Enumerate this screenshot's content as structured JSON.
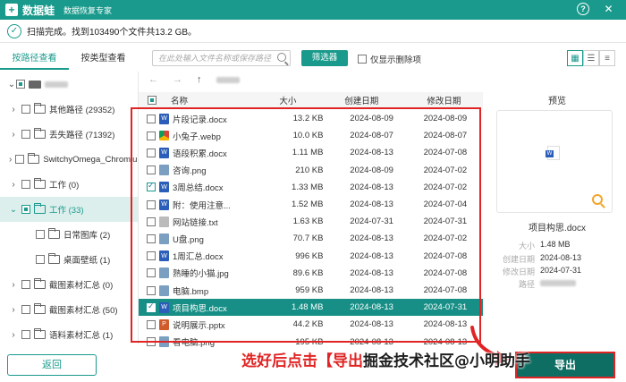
{
  "titlebar": {
    "logo_glyph": "+",
    "app_name": "数据蛙",
    "subtitle": "数据恢复专家",
    "help_glyph": "?",
    "close_glyph": "✕"
  },
  "status": {
    "text": "扫描完成。找到103490个文件共13.2 GB。",
    "check_glyph": "✓"
  },
  "left_tabs": {
    "path_view": "按路径查看",
    "type_view": "按类型查看"
  },
  "tree": [
    {
      "label": "",
      "chev": "",
      "type": "drive"
    },
    {
      "label": "其他路径 (29352)",
      "chev": "›"
    },
    {
      "label": "丢失路径 (71392)",
      "chev": "›"
    },
    {
      "label": "SwitchyOmega_Chromium",
      "chev": "›"
    },
    {
      "label": "工作 (0)",
      "chev": "›"
    },
    {
      "label": "工作 (33)",
      "chev": "⌄"
    },
    {
      "label": "日常图库 (2)",
      "chev": ""
    },
    {
      "label": "桌面壁纸 (1)",
      "chev": ""
    },
    {
      "label": "截图素材汇总 (0)",
      "chev": "›"
    },
    {
      "label": "截图素材汇总 (50)",
      "chev": "›"
    },
    {
      "label": "语料素材汇总 (1)",
      "chev": "›"
    }
  ],
  "back_button": "返回",
  "toolbar": {
    "search_placeholder": "在此处输入文件名称或保存路径",
    "filter_label": "筛选器",
    "only_deleted_label": "仅显示删除项"
  },
  "nav": {
    "back": "←",
    "forward": "→",
    "up": "↑"
  },
  "columns": {
    "name": "名称",
    "size": "大小",
    "created": "创建日期",
    "modified": "修改日期"
  },
  "files": [
    {
      "name": "片段记录.docx",
      "size": "13.2 KB",
      "created": "2024-08-09",
      "modified": "2024-08-09",
      "icon": "word",
      "checked": false,
      "selected": false
    },
    {
      "name": "小兔子.webp",
      "size": "10.0 KB",
      "created": "2024-08-07",
      "modified": "2024-08-07",
      "icon": "chrome",
      "checked": false,
      "selected": false
    },
    {
      "name": "语段积累.docx",
      "size": "1.11 MB",
      "created": "2024-08-13",
      "modified": "2024-07-08",
      "icon": "word",
      "checked": false,
      "selected": false
    },
    {
      "name": "咨询.png",
      "size": "210 KB",
      "created": "2024-08-09",
      "modified": "2024-07-02",
      "icon": "img",
      "checked": false,
      "selected": false
    },
    {
      "name": "3周总结.docx",
      "size": "1.33 MB",
      "created": "2024-08-13",
      "modified": "2024-07-02",
      "icon": "word",
      "checked": true,
      "selected": false
    },
    {
      "name": "附：使用注意...",
      "size": "1.52 MB",
      "created": "2024-08-13",
      "modified": "2024-07-04",
      "icon": "word",
      "checked": false,
      "selected": false
    },
    {
      "name": "网站链接.txt",
      "size": "1.63 KB",
      "created": "2024-07-31",
      "modified": "2024-07-31",
      "icon": "txt",
      "checked": false,
      "selected": false
    },
    {
      "name": "U盘.png",
      "size": "70.7 KB",
      "created": "2024-08-13",
      "modified": "2024-07-02",
      "icon": "img",
      "checked": false,
      "selected": false
    },
    {
      "name": "1周汇总.docx",
      "size": "996 KB",
      "created": "2024-08-13",
      "modified": "2024-07-08",
      "icon": "word",
      "checked": false,
      "selected": false
    },
    {
      "name": "熟睡的小猫.jpg",
      "size": "89.6 KB",
      "created": "2024-08-13",
      "modified": "2024-07-08",
      "icon": "img",
      "checked": false,
      "selected": false
    },
    {
      "name": "电脑.bmp",
      "size": "959 KB",
      "created": "2024-08-13",
      "modified": "2024-07-08",
      "icon": "img",
      "checked": false,
      "selected": false
    },
    {
      "name": "项目构思.docx",
      "size": "1.48 MB",
      "created": "2024-08-13",
      "modified": "2024-07-31",
      "icon": "word",
      "checked": true,
      "selected": true
    },
    {
      "name": "说明展示.pptx",
      "size": "44.2 KB",
      "created": "2024-08-13",
      "modified": "2024-08-13",
      "icon": "ppt",
      "checked": false,
      "selected": false
    },
    {
      "name": "看电脑.png",
      "size": "195 KB",
      "created": "2024-08-13",
      "modified": "2024-08-13",
      "icon": "img",
      "checked": false,
      "selected": false
    }
  ],
  "preview": {
    "title": "预览",
    "filename": "项目构思.docx",
    "size_label": "大小",
    "size_value": "1.48 MB",
    "created_label": "创建日期",
    "created_value": "2024-08-13",
    "modified_label": "修改日期",
    "modified_value": "2024-07-31",
    "path_label": "路径"
  },
  "export_button": "导出",
  "overlay": {
    "caption": "选好后点击【导出",
    "watermark": "掘金技术社区@小明助手"
  },
  "colors": {
    "accent": "#1a9a8c",
    "selected_row": "#178f86",
    "annotation_red": "#e02424"
  }
}
